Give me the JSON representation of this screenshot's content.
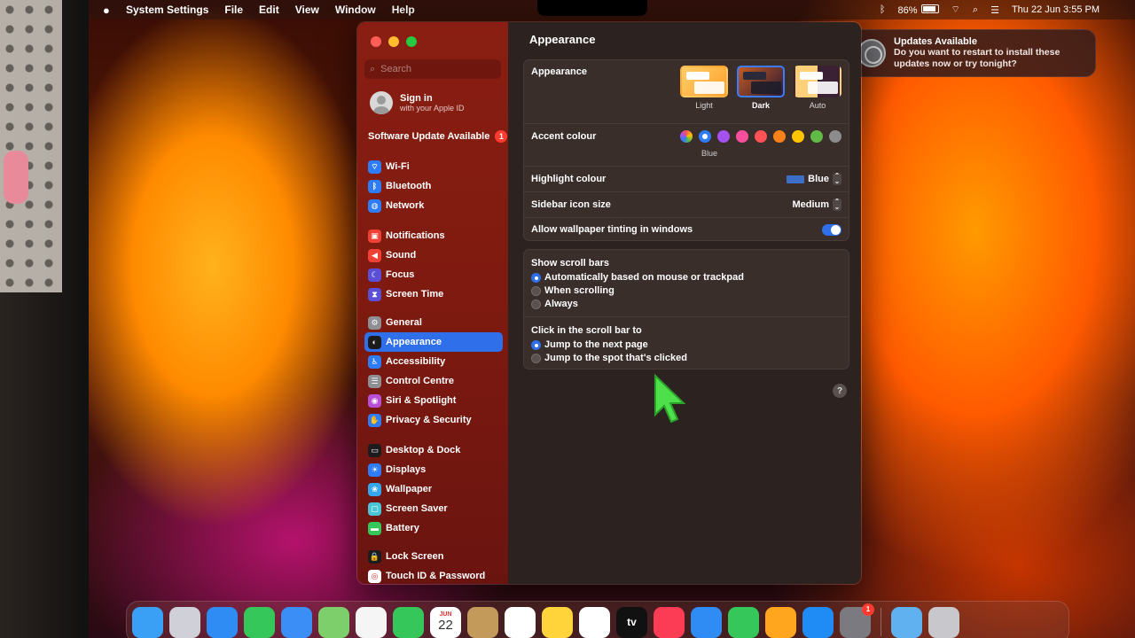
{
  "menubar": {
    "app_name": "System Settings",
    "menus": [
      "File",
      "Edit",
      "View",
      "Window",
      "Help"
    ],
    "battery": "86%",
    "clock": "Thu 22 Jun  3:55 PM"
  },
  "sidebar": {
    "search_placeholder": "Search",
    "sign_in": {
      "title": "Sign in",
      "subtitle": "with your Apple ID"
    },
    "software_update": {
      "label": "Software Update Available",
      "badge": "1"
    },
    "groups": [
      [
        {
          "label": "Wi-Fi",
          "icon": "wifi-icon",
          "color": "#2f7df6",
          "glyph": "⌔"
        },
        {
          "label": "Bluetooth",
          "icon": "bluetooth-icon",
          "color": "#2f7df6",
          "glyph": "ᛒ"
        },
        {
          "label": "Network",
          "icon": "network-icon",
          "color": "#2f7df6",
          "glyph": "◍"
        }
      ],
      [
        {
          "label": "Notifications",
          "icon": "notifications-icon",
          "color": "#ef4136",
          "glyph": "▣"
        },
        {
          "label": "Sound",
          "icon": "sound-icon",
          "color": "#ef4136",
          "glyph": "◀"
        },
        {
          "label": "Focus",
          "icon": "focus-icon",
          "color": "#5b4fd6",
          "glyph": "☾"
        },
        {
          "label": "Screen Time",
          "icon": "screen-time-icon",
          "color": "#5b4fd6",
          "glyph": "⧗"
        }
      ],
      [
        {
          "label": "General",
          "icon": "general-icon",
          "color": "#8e8e93",
          "glyph": "⚙"
        },
        {
          "label": "Appearance",
          "icon": "appearance-icon",
          "color": "#1c1c1e",
          "glyph": "◐",
          "active": true
        },
        {
          "label": "Accessibility",
          "icon": "accessibility-icon",
          "color": "#2f7df6",
          "glyph": "♿"
        },
        {
          "label": "Control Centre",
          "icon": "control-centre-icon",
          "color": "#8e8e93",
          "glyph": "☰"
        },
        {
          "label": "Siri & Spotlight",
          "icon": "siri-icon",
          "color": "#b84fd6",
          "glyph": "◉"
        },
        {
          "label": "Privacy & Security",
          "icon": "privacy-icon",
          "color": "#2f7df6",
          "glyph": "✋"
        }
      ],
      [
        {
          "label": "Desktop & Dock",
          "icon": "desktop-dock-icon",
          "color": "#1c1c1e",
          "glyph": "▭"
        },
        {
          "label": "Displays",
          "icon": "displays-icon",
          "color": "#2f7df6",
          "glyph": "☀"
        },
        {
          "label": "Wallpaper",
          "icon": "wallpaper-icon",
          "color": "#33a6ec",
          "glyph": "❀"
        },
        {
          "label": "Screen Saver",
          "icon": "screen-saver-icon",
          "color": "#49c6d6",
          "glyph": "▢"
        },
        {
          "label": "Battery",
          "icon": "battery-icon",
          "color": "#34c759",
          "glyph": "▬"
        }
      ],
      [
        {
          "label": "Lock Screen",
          "icon": "lock-screen-icon",
          "color": "#1c1c1e",
          "glyph": "🔒"
        },
        {
          "label": "Touch ID & Password",
          "icon": "touch-id-icon",
          "color": "#ffffff",
          "glyph": "◎"
        }
      ]
    ]
  },
  "content": {
    "title": "Appearance",
    "appearance": {
      "label": "Appearance",
      "options": [
        {
          "label": "Light",
          "selected": false
        },
        {
          "label": "Dark",
          "selected": true
        },
        {
          "label": "Auto",
          "selected": false
        }
      ]
    },
    "accent": {
      "label": "Accent colour",
      "selected_label": "Blue",
      "colors": [
        "multicolor",
        "#2f7df6",
        "#a550f0",
        "#f74f9e",
        "#ff5257",
        "#f7821b",
        "#ffc600",
        "#62ba46",
        "#8c8c8c"
      ]
    },
    "highlight": {
      "label": "Highlight colour",
      "value": "Blue"
    },
    "sidebar_icon_size": {
      "label": "Sidebar icon size",
      "value": "Medium"
    },
    "wallpaper_tinting": {
      "label": "Allow wallpaper tinting in windows",
      "on": true
    },
    "scroll_bars": {
      "label": "Show scroll bars",
      "options": [
        {
          "label": "Automatically based on mouse or trackpad",
          "selected": true
        },
        {
          "label": "When scrolling",
          "selected": false
        },
        {
          "label": "Always",
          "selected": false
        }
      ]
    },
    "click_scroll_bar": {
      "label": "Click in the scroll bar to",
      "options": [
        {
          "label": "Jump to the next page",
          "selected": true
        },
        {
          "label": "Jump to the spot that's clicked",
          "selected": false
        }
      ]
    },
    "help": "?"
  },
  "notification": {
    "title": "Updates Available",
    "body": "Do you want to restart to install these updates now or try tonight?"
  },
  "dock": {
    "apps": [
      {
        "name": "finder-icon",
        "color": "#3aa0f5"
      },
      {
        "name": "launchpad-icon",
        "color": "#d0d0d8"
      },
      {
        "name": "safari-icon",
        "color": "#2f8cf5"
      },
      {
        "name": "messages-icon",
        "color": "#35c759"
      },
      {
        "name": "mail-icon",
        "color": "#3a8ef6"
      },
      {
        "name": "maps-icon",
        "color": "#7ccf6b"
      },
      {
        "name": "photos-icon",
        "color": "#f5f5f5"
      },
      {
        "name": "facetime-icon",
        "color": "#35c759"
      },
      {
        "name": "calendar-icon",
        "color": "#ffffff",
        "month": "JUN",
        "day": "22"
      },
      {
        "name": "contacts-icon",
        "color": "#c49a5a"
      },
      {
        "name": "reminders-icon",
        "color": "#ffffff"
      },
      {
        "name": "notes-icon",
        "color": "#ffd43b"
      },
      {
        "name": "freeform-icon",
        "color": "#ffffff"
      },
      {
        "name": "tv-icon",
        "color": "#111111",
        "text": "tv"
      },
      {
        "name": "music-icon",
        "color": "#fc3c55"
      },
      {
        "name": "keynote-icon",
        "color": "#2f8cf5"
      },
      {
        "name": "numbers-icon",
        "color": "#35c759"
      },
      {
        "name": "pages-icon",
        "color": "#ffa51e"
      },
      {
        "name": "app-store-icon",
        "color": "#1f8cf5"
      },
      {
        "name": "system-settings-icon",
        "color": "#7a7a80",
        "badge": "1"
      }
    ],
    "right": [
      {
        "name": "downloads-folder-icon",
        "color": "#5fb1f0"
      },
      {
        "name": "trash-icon",
        "color": "#c8c8cc"
      }
    ]
  }
}
